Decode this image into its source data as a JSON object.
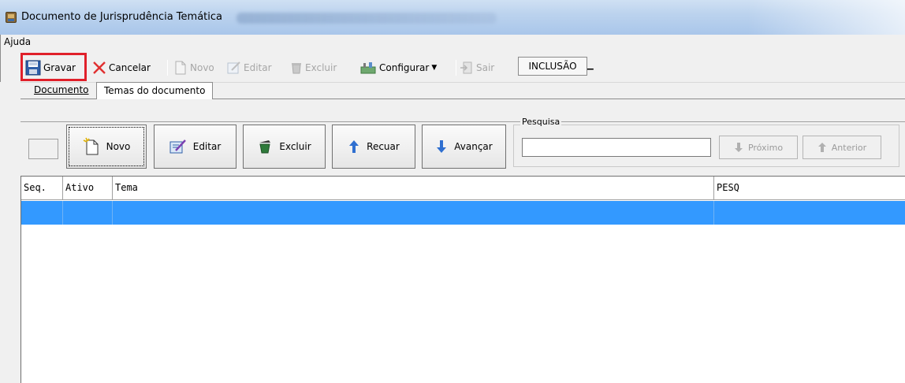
{
  "window": {
    "title": "Documento de Jurisprudência Temática",
    "blurred_title_suffix": ""
  },
  "menu": {
    "items": [
      "Ajuda"
    ]
  },
  "toolbar": {
    "gravar": "Gravar",
    "cancelar": "Cancelar",
    "novo": "Novo",
    "editar": "Editar",
    "excluir": "Excluir",
    "configurar": "Configurar",
    "sair": "Sair",
    "mode": "INCLUSÃO"
  },
  "tabs": [
    {
      "label": "Documento",
      "active": false
    },
    {
      "label": "Temas do documento",
      "active": true
    }
  ],
  "actions": {
    "novo": "Novo",
    "editar": "Editar",
    "excluir": "Excluir",
    "recuar": "Recuar",
    "avancar": "Avançar"
  },
  "search": {
    "legend": "Pesquisa",
    "value": "",
    "proximo": "Próximo",
    "anterior": "Anterior"
  },
  "grid": {
    "columns": [
      "Seq.",
      "Ativo",
      "Tema",
      "PESQ"
    ],
    "rows": [
      {
        "seq": "",
        "ativo": "",
        "tema": "",
        "pesq": "",
        "selected": true
      }
    ]
  },
  "colors": {
    "selection": "#3399ff",
    "highlight_border": "#e0202a"
  }
}
